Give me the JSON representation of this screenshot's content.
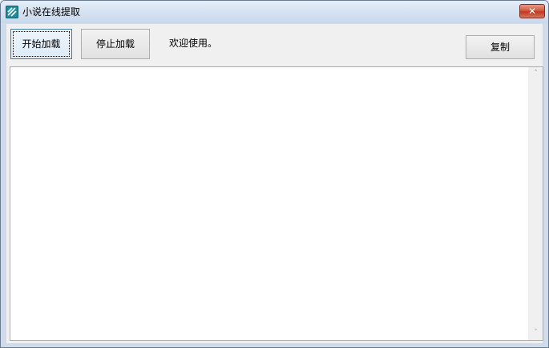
{
  "window": {
    "title": "小说在线提取",
    "close_symbol": "✕",
    "icon": "app-icon"
  },
  "toolbar": {
    "start_label": "开始加载",
    "stop_label": "停止加载",
    "status_text": "欢迎使用。",
    "copy_label": "复制"
  },
  "output": {
    "content": "",
    "scroll_up": "˄",
    "scroll_down": "˅"
  }
}
